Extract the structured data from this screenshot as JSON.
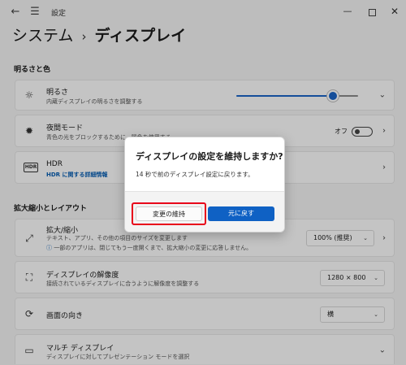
{
  "titlebar": {
    "title": "設定",
    "back_icon": "←",
    "menu_icon": "☰",
    "minimize": "—",
    "close": "✕"
  },
  "breadcrumb": {
    "parent": "システム",
    "separator": "›",
    "current": "ディスプレイ"
  },
  "sections": {
    "brightness_color": "明るさと色",
    "scale_layout": "拡大縮小とレイアウト"
  },
  "cards": {
    "brightness": {
      "icon": "☼",
      "title": "明るさ",
      "subtitle": "内蔵ディスプレイの明るさを調整する",
      "slider_value_percent": 79
    },
    "night_light": {
      "icon": "✹",
      "title": "夜間モード",
      "subtitle": "青色の光をブロックするために、暖色を使用する",
      "toggle_label": "オフ",
      "toggle_on": false
    },
    "hdr": {
      "icon": "HDR",
      "title": "HDR",
      "subtitle_link": "HDR に関する詳細情報"
    },
    "scale": {
      "icon": "⤢",
      "title": "拡大/縮小",
      "subtitle": "テキスト、アプリ、その他の項目のサイズを変更します",
      "info_icon": "ⓘ",
      "notice": "一部のアプリは、閉じてもう一度開くまで、拡大縮小の変更に応答しません。",
      "value": "100% (推奨)"
    },
    "resolution": {
      "icon": "⛶",
      "title": "ディスプレイの解像度",
      "subtitle": "接続されているディスプレイに合うように解像度を調整する",
      "value": "1280 × 800"
    },
    "orientation": {
      "icon": "⟳",
      "title": "画面の向き",
      "value": "横"
    },
    "multi_display": {
      "icon": "▭",
      "title": "マルチ ディスプレイ",
      "subtitle": "ディスプレイに対してプレゼンテーション モードを選択"
    }
  },
  "dialog": {
    "title": "ディスプレイの設定を維持しますか?",
    "body": "14 秒で前のディスプレイ設定に戻ります。",
    "keep_label": "変更の維持",
    "revert_label": "元に戻す"
  },
  "colors": {
    "accent": "#0f61c4",
    "highlight": "#e8001a"
  }
}
